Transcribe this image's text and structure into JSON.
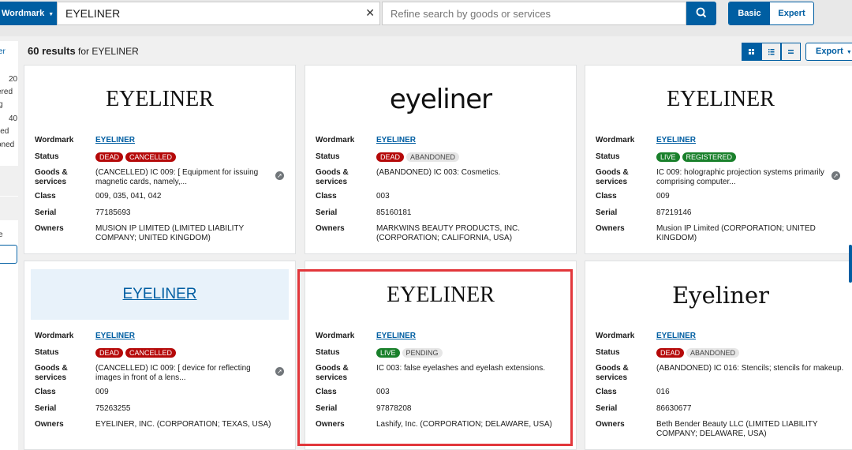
{
  "search": {
    "type_label": "Wordmark",
    "query": "EYELINER",
    "refine_placeholder": "Refine search by goods or services",
    "modes": {
      "basic": "Basic",
      "expert": "Expert"
    }
  },
  "sidebar": {
    "fragments": [
      "er",
      "20",
      "ered",
      "g",
      "40",
      "led",
      "oned",
      "e"
    ]
  },
  "results": {
    "count": "60 results",
    "for_text": "for EYELINER",
    "export_label": "Export"
  },
  "labels": {
    "wordmark": "Wordmark",
    "status": "Status",
    "goods1": "Goods &",
    "goods2": "services",
    "class": "Class",
    "serial": "Serial",
    "owners": "Owners"
  },
  "cards": [
    {
      "mark": "EYELINER",
      "wordmark": "EYELINER",
      "status": [
        "DEAD",
        "CANCELLED"
      ],
      "goods": "(CANCELLED) IC 009: [ Equipment for issuing magnetic cards, namely,...",
      "class": "009, 035, 041, 042",
      "serial": "77185693",
      "owners": "MUSION IP LIMITED (LIMITED LIABILITY COMPANY; UNITED KINGDOM)"
    },
    {
      "mark": "eyeliner",
      "wordmark": "EYELINER",
      "status": [
        "DEAD",
        "ABANDONED"
      ],
      "goods": "(ABANDONED) IC 003: Cosmetics.",
      "class": "003",
      "serial": "85160181",
      "owners": "MARKWINS BEAUTY PRODUCTS, INC. (CORPORATION; CALIFORNIA, USA)"
    },
    {
      "mark": "EYELINER",
      "wordmark": "EYELINER",
      "status": [
        "LIVE",
        "REGISTERED"
      ],
      "goods": "IC 009: holographic projection systems primarily comprising computer...",
      "class": "009",
      "serial": "87219146",
      "owners": "Musion IP Limited (CORPORATION; UNITED KINGDOM)"
    },
    {
      "mark": "EYELINER",
      "wordmark": "EYELINER",
      "status": [
        "DEAD",
        "CANCELLED"
      ],
      "goods": "(CANCELLED) IC 009: [ device for reflecting images in front of a lens...",
      "class": "009",
      "serial": "75263255",
      "owners": "EYELINER, INC. (CORPORATION; TEXAS, USA)"
    },
    {
      "mark": "EYELINER",
      "wordmark": "EYELINER",
      "status": [
        "LIVE",
        "PENDING"
      ],
      "goods": "IC 003: false eyelashes and eyelash extensions.",
      "class": "003",
      "serial": "97878208",
      "owners": "Lashify, Inc. (CORPORATION; DELAWARE, USA)"
    },
    {
      "mark": "Eyeliner",
      "wordmark": "EYELINER",
      "status": [
        "DEAD",
        "ABANDONED"
      ],
      "goods": "(ABANDONED) IC 016: Stencils; stencils for makeup.",
      "class": "016",
      "serial": "86630677",
      "owners": "Beth Bender Beauty LLC (LIMITED LIABILITY COMPANY; DELAWARE, USA)"
    }
  ]
}
